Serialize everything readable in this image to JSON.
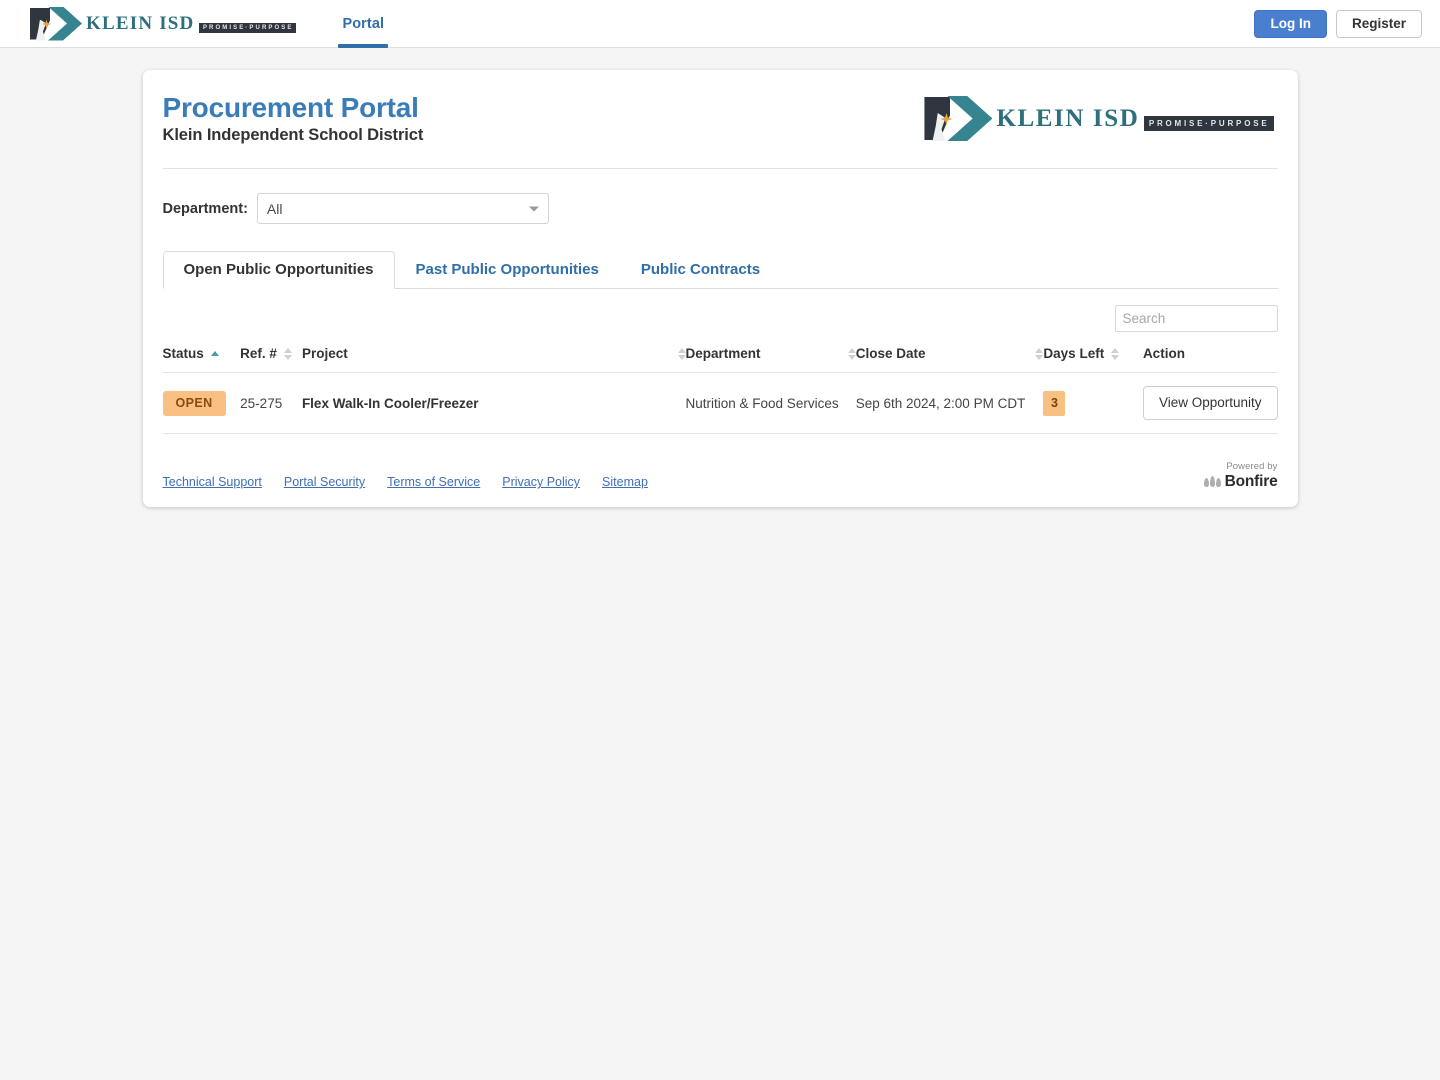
{
  "brand": {
    "logo_icon": "klein-isd-logo-icon",
    "name": "KLEIN ISD",
    "tagline": "PROMISE·PURPOSE",
    "accent_teal": "#35848f",
    "accent_blue": "#3a7cb8",
    "accent_orange": "#f8c182"
  },
  "navbar": {
    "tabs": [
      {
        "label": "Portal",
        "active": true
      }
    ],
    "login_label": "Log In",
    "register_label": "Register"
  },
  "header": {
    "title": "Procurement Portal",
    "subtitle": "Klein Independent School District"
  },
  "filter": {
    "label": "Department:",
    "value": "All",
    "caret_icon": "chevron-down-icon",
    "options": [
      "All"
    ]
  },
  "tabs": [
    {
      "label": "Open Public Opportunities",
      "active": true
    },
    {
      "label": "Past Public Opportunities",
      "active": false
    },
    {
      "label": "Public Contracts",
      "active": false
    }
  ],
  "search": {
    "value": "",
    "placeholder": "Search"
  },
  "table": {
    "columns": [
      {
        "label": "Status",
        "sort": "asc"
      },
      {
        "label": "Ref. #",
        "sort": "none"
      },
      {
        "label": "Project",
        "sort": "none"
      },
      {
        "label": "Department",
        "sort": "none"
      },
      {
        "label": "Close Date",
        "sort": "none"
      },
      {
        "label": "Days Left",
        "sort": "none"
      },
      {
        "label": "Action",
        "sort": null
      }
    ],
    "rows": [
      {
        "status": "OPEN",
        "ref": "25-275",
        "project": "Flex Walk-In Cooler/Freezer",
        "department": "Nutrition & Food Services",
        "close_date": "Sep 6th 2024, 2:00 PM CDT",
        "days_left": "3",
        "action_label": "View Opportunity"
      }
    ]
  },
  "footer": {
    "links": [
      "Technical Support",
      "Portal Security",
      "Terms of Service",
      "Privacy Policy",
      "Sitemap"
    ],
    "powered_by": "Powered by",
    "vendor": "Bonfire",
    "vendor_icon": "bonfire-flames-icon"
  }
}
